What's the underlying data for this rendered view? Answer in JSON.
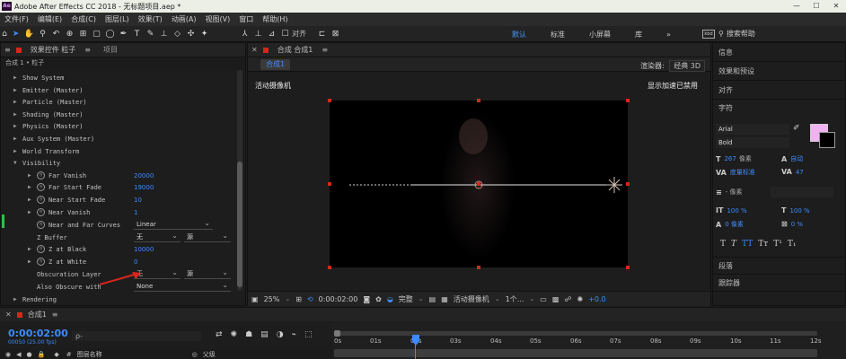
{
  "window": {
    "title": "Adobe After Effects CC 2018 - 无标题项目.aep *",
    "logo_text": "Ae",
    "min": "—",
    "max": "☐",
    "close": "✕"
  },
  "menu": [
    "文件(F)",
    "编辑(E)",
    "合成(C)",
    "图层(L)",
    "效果(T)",
    "动画(A)",
    "视图(V)",
    "窗口",
    "帮助(H)"
  ],
  "toolbar": {
    "snap_label": "对齐",
    "workspaces": [
      "默认",
      "标准",
      "小屏幕",
      "库"
    ],
    "active_workspace": "默认",
    "search_placeholder": "搜索帮助",
    "kb_label": "kbd"
  },
  "effect_controls": {
    "tab_label": "效果控件 粒子",
    "project_tab": "项目",
    "breadcrumb": "合成 1 • 粒子",
    "groups_top": [
      "Show System",
      "Emitter (Master)",
      "Particle (Master)",
      "Shading (Master)",
      "Physics (Master)",
      "Aux System (Master)",
      "World Transform",
      "Visibility"
    ],
    "props": [
      {
        "label": "Far Vanish",
        "value": "20000"
      },
      {
        "label": "Far Start Fade",
        "value": "19000"
      },
      {
        "label": "Near Start Fade",
        "value": "10"
      },
      {
        "label": "Near Vanish",
        "value": "1"
      }
    ],
    "near_far_curves": {
      "label": "Near and Far Curves",
      "value": "Linear"
    },
    "z_buffer": {
      "label": "Z Buffer",
      "value": "无",
      "value2": "源"
    },
    "z_black": {
      "label": "Z at Black",
      "value": "10000"
    },
    "z_white": {
      "label": "Z at White",
      "value": "0"
    },
    "obscuration": {
      "label": "Obscuration Layer",
      "value": "无",
      "value2": "源"
    },
    "also_obscure": {
      "label": "Also Obscure with",
      "value": "None"
    },
    "rendering": "Rendering"
  },
  "composition": {
    "tab_label": "合成 合成1",
    "sub_tab": "合成1",
    "renderer_label": "渲染器:",
    "renderer_value": "经典 3D",
    "camera_label": "活动摄像机",
    "gpu_label": "显示加速已禁用",
    "footer": {
      "zoom": "25%",
      "timecode": "0:00:02:00",
      "quality": "完整",
      "view": "活动摄像机",
      "views_count": "1个...",
      "exposure": "+0.0"
    }
  },
  "right_panel": {
    "sections_top": [
      "信息",
      "效果和预设",
      "对齐"
    ],
    "character_title": "字符",
    "font": "Arial",
    "style": "Bold",
    "size": {
      "value": "267",
      "unit": "像素"
    },
    "leading": {
      "value": "自动"
    },
    "kerning": {
      "value": "度量标准"
    },
    "tracking": {
      "value": "47"
    },
    "stroke_width": {
      "value": "- 像素"
    },
    "vscale": {
      "value": "100 %"
    },
    "hscale": {
      "value": "100 %"
    },
    "baseline": {
      "value": "0 像素"
    },
    "tsume": {
      "value": "0 %"
    },
    "type_buttons": [
      "T",
      "T",
      "TT",
      "Tт",
      "T¹",
      "T₁"
    ],
    "sections_bottom": [
      "段落",
      "跟踪器"
    ],
    "fill_color": "#f1b2f2",
    "stroke_color": "#000000"
  },
  "timeline": {
    "tab_label": "合成1",
    "timecode": "0:00:02:00",
    "fps": "00050 (25.00 fps)",
    "search_placeholder": "ρ-",
    "col_layer_name": "图层名称",
    "col_parent": "父级",
    "ticks": [
      "0s",
      "01s",
      "02s",
      "03s",
      "04s",
      "05s",
      "06s",
      "07s",
      "08s",
      "09s",
      "10s",
      "11s",
      "12s"
    ]
  },
  "colors": {
    "accent_blue": "#3b8cff",
    "handle_red": "#d9261c",
    "arrow_red": "#d9261c"
  }
}
